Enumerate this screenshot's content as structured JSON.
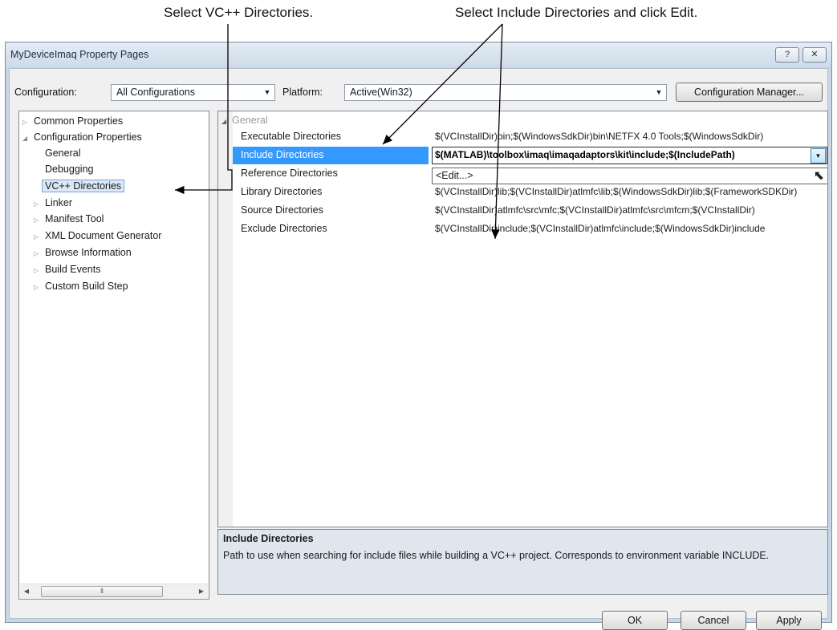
{
  "captions": {
    "left": "Select VC++ Directories.",
    "right": "Select Include Directories and click Edit."
  },
  "window": {
    "title": "MyDeviceImaq Property Pages",
    "help_label": "?",
    "close_label": "☒"
  },
  "config_bar": {
    "configuration_label": "Configuration:",
    "configuration_value": "All Configurations",
    "platform_label": "Platform:",
    "platform_value": "Active(Win32)",
    "manager_button": "Configuration Manager..."
  },
  "tree": {
    "items": [
      {
        "label": "Common Properties",
        "expander": "▷"
      },
      {
        "label": "Configuration Properties",
        "expander": "◢"
      },
      {
        "label": "General",
        "expander": ""
      },
      {
        "label": "Debugging",
        "expander": ""
      },
      {
        "label": "VC++ Directories",
        "expander": ""
      },
      {
        "label": "Linker",
        "expander": "▷"
      },
      {
        "label": "Manifest Tool",
        "expander": "▷"
      },
      {
        "label": "XML Document Generator",
        "expander": "▷"
      },
      {
        "label": "Browse Information",
        "expander": "▷"
      },
      {
        "label": "Build Events",
        "expander": "▷"
      },
      {
        "label": "Custom Build Step",
        "expander": "▷"
      }
    ],
    "selected": "VC++ Directories"
  },
  "grid": {
    "category": "General",
    "rows": [
      {
        "name": "Executable Directories",
        "value": "$(VCInstallDir)bin;$(WindowsSdkDir)bin\\NETFX 4.0 Tools;$(WindowsSdkDir)"
      },
      {
        "name": "Include Directories",
        "value": "$(MATLAB)\\toolbox\\imaq\\imaqadaptors\\kit\\include;$(IncludePath)"
      },
      {
        "name": "Reference Directories",
        "value": ""
      },
      {
        "name": "Library Directories",
        "value": "$(VCInstallDir)lib;$(VCInstallDir)atlmfc\\lib;$(WindowsSdkDir)lib;$(FrameworkSDKDir)"
      },
      {
        "name": "Source Directories",
        "value": "$(VCInstallDir)atlmfc\\src\\mfc;$(VCInstallDir)atlmfc\\src\\mfcm;$(VCInstallDir)"
      },
      {
        "name": "Exclude Directories",
        "value": "$(VCInstallDir)include;$(VCInstallDir)atlmfc\\include;$(WindowsSdkDir)include"
      }
    ],
    "selected": "Include Directories",
    "dropdown_option": "<Edit...>"
  },
  "description": {
    "title": "Include Directories",
    "text": "Path to use when searching for include files while building a VC++ project.  Corresponds to environment variable INCLUDE."
  },
  "buttons": {
    "ok": "OK",
    "cancel": "Cancel",
    "apply": "Apply"
  },
  "icons": {
    "dropdown": "chevron-down-icon",
    "cursor": "mouse-pointer-icon"
  },
  "colors": {
    "selection": "#3399ff",
    "title_bar": "#cfdbea"
  }
}
